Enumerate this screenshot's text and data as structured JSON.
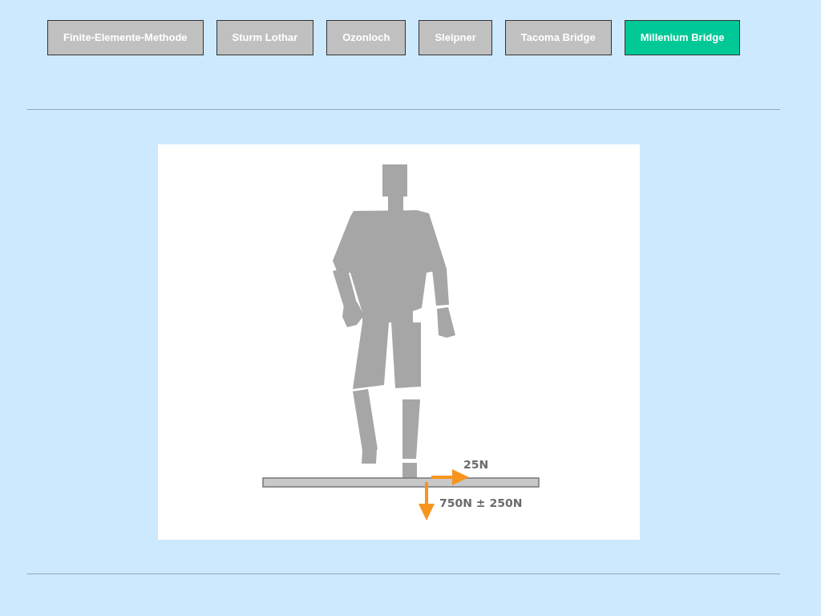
{
  "nav_buttons": [
    {
      "label": "Finite-Elemente-Methode",
      "selected": false
    },
    {
      "label": "Sturm Lothar",
      "selected": false
    },
    {
      "label": "Ozonloch",
      "selected": false
    },
    {
      "label": "Sleipner",
      "selected": false
    },
    {
      "label": "Tacoma Bridge",
      "selected": false
    },
    {
      "label": "Millenium Bridge",
      "selected": true
    }
  ],
  "diagram": {
    "forces": [
      {
        "kind": "horizontal",
        "label": "25N"
      },
      {
        "kind": "vertical",
        "label": "750N ± 250N"
      }
    ]
  }
}
